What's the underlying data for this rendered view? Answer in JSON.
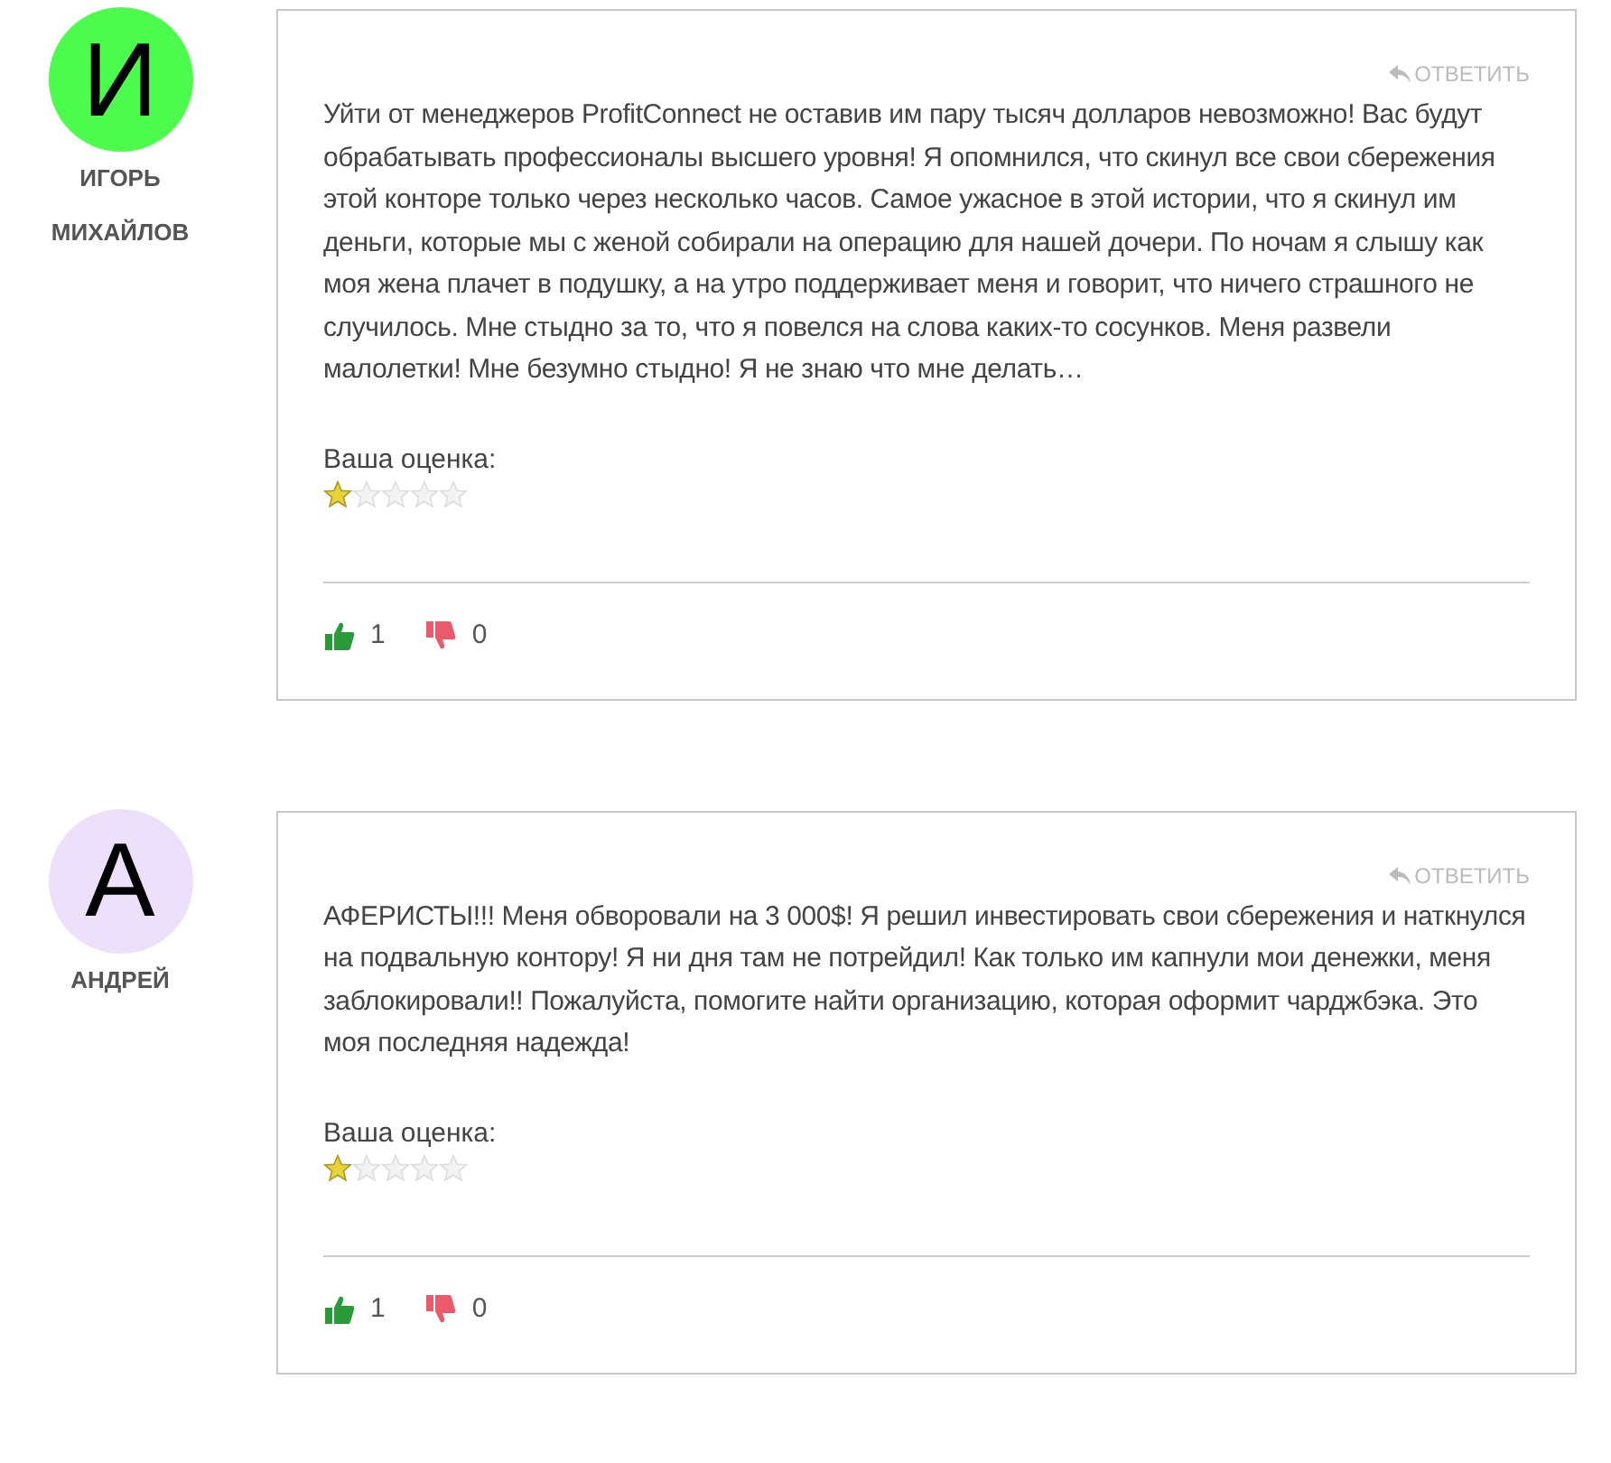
{
  "reviews": [
    {
      "avatar_letter": "И",
      "color": "#4cfc4c",
      "author": "ИГОРЬ МИХАЙЛОВ",
      "reply": "ОТВЕТИТЬ",
      "text": "Уйти от менеджеров ProfitConnect не оставив им пару тысяч долларов невозможно! Вас будут обрабатывать профессионалы высшего уровня! Я опомнился, что скинул все свои сбережения этой конторе только через несколько часов. Самое ужасное в этой истории, что я скинул им деньги, которые мы с женой собирали на операцию для нашей дочери. По ночам я слышу как моя жена плачет в подушку, а на утро поддерживает меня и говорит, что ничего страшного не случилось. Мне стыдно за то, что я повелся на слова каких-то сосунков. Меня развели малолетки! Мне безумно стыдно! Я не знаю что мне делать…",
      "rating_label": "Ваша оценка:",
      "stars": 1,
      "likes": "1",
      "dislikes": "0"
    },
    {
      "avatar_letter": "А",
      "color": "#ede0fb",
      "author": "АНДРЕЙ",
      "reply": "ОТВЕТИТЬ",
      "text": "АФЕРИСТЫ!!! Меня обворовали на 3 000$! Я решил инвестировать свои сбережения и наткнулся на подвальную контору! Я ни дня там не потрейдил! Как только им капнули мои денежки, меня заблокировали!! Пожалуйста, помогите найти организацию, которая оформит чарджбэка. Это моя последняя надежда!",
      "rating_label": "Ваша оценка:",
      "stars": 1,
      "likes": "1",
      "dislikes": "0"
    }
  ]
}
